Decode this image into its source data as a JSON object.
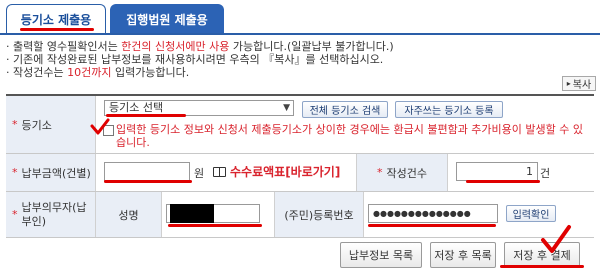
{
  "tabs": {
    "active": "등기소 제출용",
    "inactive": "집행법원 제출용"
  },
  "notices": {
    "line1_prefix": "· 출력할 영수필확인서는 ",
    "line1_highlight": "한건의 신청서에만 사용",
    "line1_suffix": " 가능합니다.(일괄납부 불가합니다.)",
    "line2": "· 기존에 작성완료된 납부정보를 재사용하시려면 우측의 『복사』를 선택하십시오.",
    "line3_prefix": "· 작성건수는 ",
    "line3_highlight": "10건까지",
    "line3_suffix": " 입력가능합니다."
  },
  "copy_button": "복사",
  "registry": {
    "label": "등기소",
    "select_value": "등기소 선택",
    "search_all_button": "전체 등기소 검색",
    "frequent_button": "자주쓰는 등기소 등록",
    "warning": "입력한 등기소 정보와 신청서 제출등기소가 상이한 경우에는 환급시 불편함과 추가비용이 발생할 수 있습니다."
  },
  "payment": {
    "label": "납부금액(건별)",
    "amount_value": "",
    "unit": "원",
    "fee_link": "수수료액표[바로가기]",
    "count_label": "작성건수",
    "count_value": "1",
    "count_unit": "건"
  },
  "payer": {
    "label": "납부의무자(납부인)",
    "name_label": "성명",
    "id_label": "(주민)등록번호",
    "id_value": "●●●●●●●●●●●●●●",
    "confirm_button": "입력확인"
  },
  "footer": {
    "payment_list": "납부정보 목록",
    "save_list": "저장 후 목록",
    "save_pay": "저장 후 결제"
  },
  "colors": {
    "accent": "#2c63b5",
    "warning": "#d9232d",
    "annotation": "#e00000"
  }
}
